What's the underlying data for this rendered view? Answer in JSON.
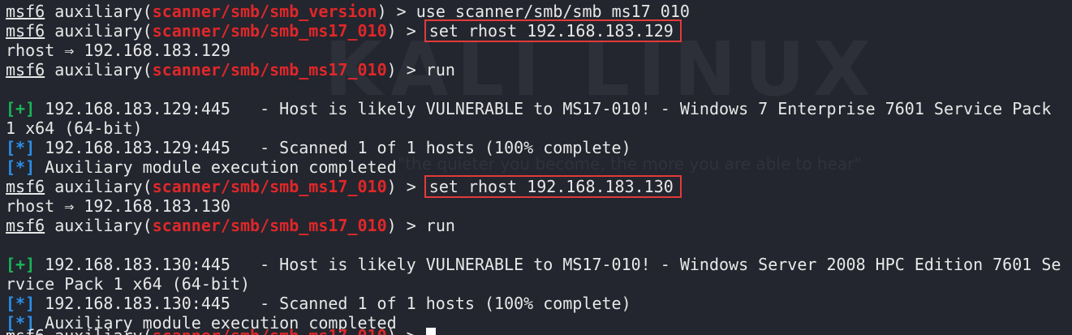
{
  "watermark": {
    "logo": "KALI LINUX",
    "tagline": "\"the quieter you become, the more you are able to hear\""
  },
  "colors": {
    "background": "#23262e",
    "module_red": "#e0272a",
    "info_blue": "#2c8fe9",
    "success_green": "#19b657",
    "highlight_box": "#e33a3a"
  },
  "terminal": {
    "prompt": "msf6",
    "aux_word": " auxiliary(",
    "close_arrow": ") > ",
    "module_old": "scanner/smb/smb_version",
    "module": "scanner/smb/smb_ms17_010",
    "cmd_use": "use scanner/smb/smb_ms17_010",
    "cmd_set1": "set rhost 192.168.183.129",
    "echo1": "rhost ⇒ 192.168.183.129",
    "cmd_run": "run",
    "tag_plus": "[+]",
    "tag_star": "[*]",
    "res1_vuln_a": " 192.168.183.129:445   - Host is likely VULNERABLE to MS17-010! - Windows 7 Enterprise 7601 Service Pack",
    "res1_vuln_b": "1 x64 (64-bit)",
    "res1_scanned": " 192.168.183.129:445   - Scanned 1 of 1 hosts (100% complete)",
    "aux_done": " Auxiliary module execution completed",
    "cmd_set2": "set rhost 192.168.183.130",
    "echo2": "rhost ⇒ 192.168.183.130",
    "res2_vuln_a": " 192.168.183.130:445   - Host is likely VULNERABLE to MS17-010! - Windows Server 2008 HPC Edition 7601 Se",
    "res2_vuln_b": "rvice Pack 1 x64 (64-bit)",
    "res2_scanned": " 192.168.183.130:445   - Scanned 1 of 1 hosts (100% complete)"
  }
}
